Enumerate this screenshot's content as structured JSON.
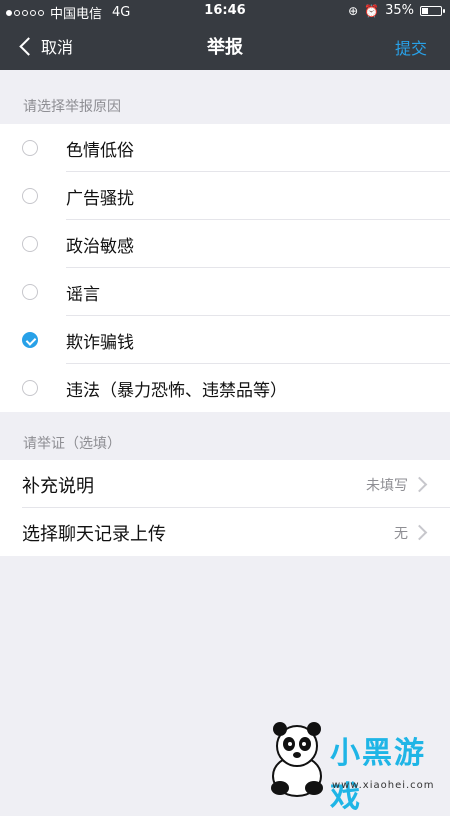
{
  "status_bar": {
    "carrier": "中国电信",
    "network": "4G",
    "time": "16:46",
    "battery": "35%",
    "battery_level": 0.35
  },
  "nav": {
    "back_label": "取消",
    "title": "举报",
    "submit_label": "提交"
  },
  "reasons": {
    "header": "请选择举报原因",
    "items": [
      {
        "label": "色情低俗",
        "checked": false
      },
      {
        "label": "广告骚扰",
        "checked": false
      },
      {
        "label": "政治敏感",
        "checked": false
      },
      {
        "label": "谣言",
        "checked": false
      },
      {
        "label": "欺诈骗钱",
        "checked": true
      },
      {
        "label": "违法（暴力恐怖、违禁品等）",
        "checked": false
      }
    ]
  },
  "evidence": {
    "header": "请举证（选填）",
    "items": [
      {
        "label": "补充说明",
        "value": "未填写"
      },
      {
        "label": "选择聊天记录上传",
        "value": "无"
      }
    ]
  },
  "watermark": {
    "text": "小黑游戏",
    "url": "www.xiaohei.com"
  },
  "colors": {
    "accent": "#28a1e8",
    "header_bg": "#373b41",
    "page_bg": "#efeff4"
  }
}
